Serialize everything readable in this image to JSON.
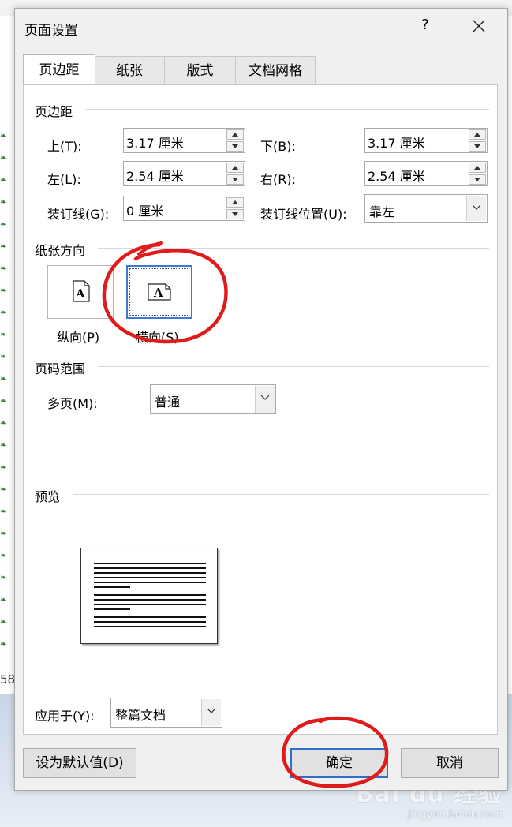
{
  "dialog": {
    "title": "页面设置",
    "help": "?",
    "tabs": [
      {
        "label": "页边距",
        "active": true
      },
      {
        "label": "纸张",
        "active": false
      },
      {
        "label": "版式",
        "active": false
      },
      {
        "label": "文档网格",
        "active": false
      }
    ]
  },
  "margins": {
    "group_title": "页边距",
    "top_label": "上(T):",
    "top_value": "3.17 厘米",
    "bottom_label": "下(B):",
    "bottom_value": "3.17 厘米",
    "left_label": "左(L):",
    "left_value": "2.54 厘米",
    "right_label": "右(R):",
    "right_value": "2.54 厘米",
    "gutter_label": "装订线(G):",
    "gutter_value": "0 厘米",
    "gutter_pos_label": "装订线位置(U):",
    "gutter_pos_value": "靠左"
  },
  "orientation": {
    "group_title": "纸张方向",
    "portrait_label": "纵向(P)",
    "landscape_label": "横向(S)",
    "icon_letter": "A",
    "selected": "landscape"
  },
  "pages": {
    "group_title": "页码范围",
    "multiple_label": "多页(M):",
    "multiple_value": "普通"
  },
  "preview": {
    "group_title": "预览",
    "apply_label": "应用于(Y):",
    "apply_value": "整篇文档"
  },
  "buttons": {
    "default": "设为默认值(D)",
    "ok": "确定",
    "cancel": "取消"
  },
  "background": {
    "left_number": "58",
    "watermark_main": "Bai du 经验",
    "watermark_sub": "jingyan.baidu.com"
  },
  "colors": {
    "accent": "#2e6dcc",
    "annotation": "#e01b1b"
  }
}
